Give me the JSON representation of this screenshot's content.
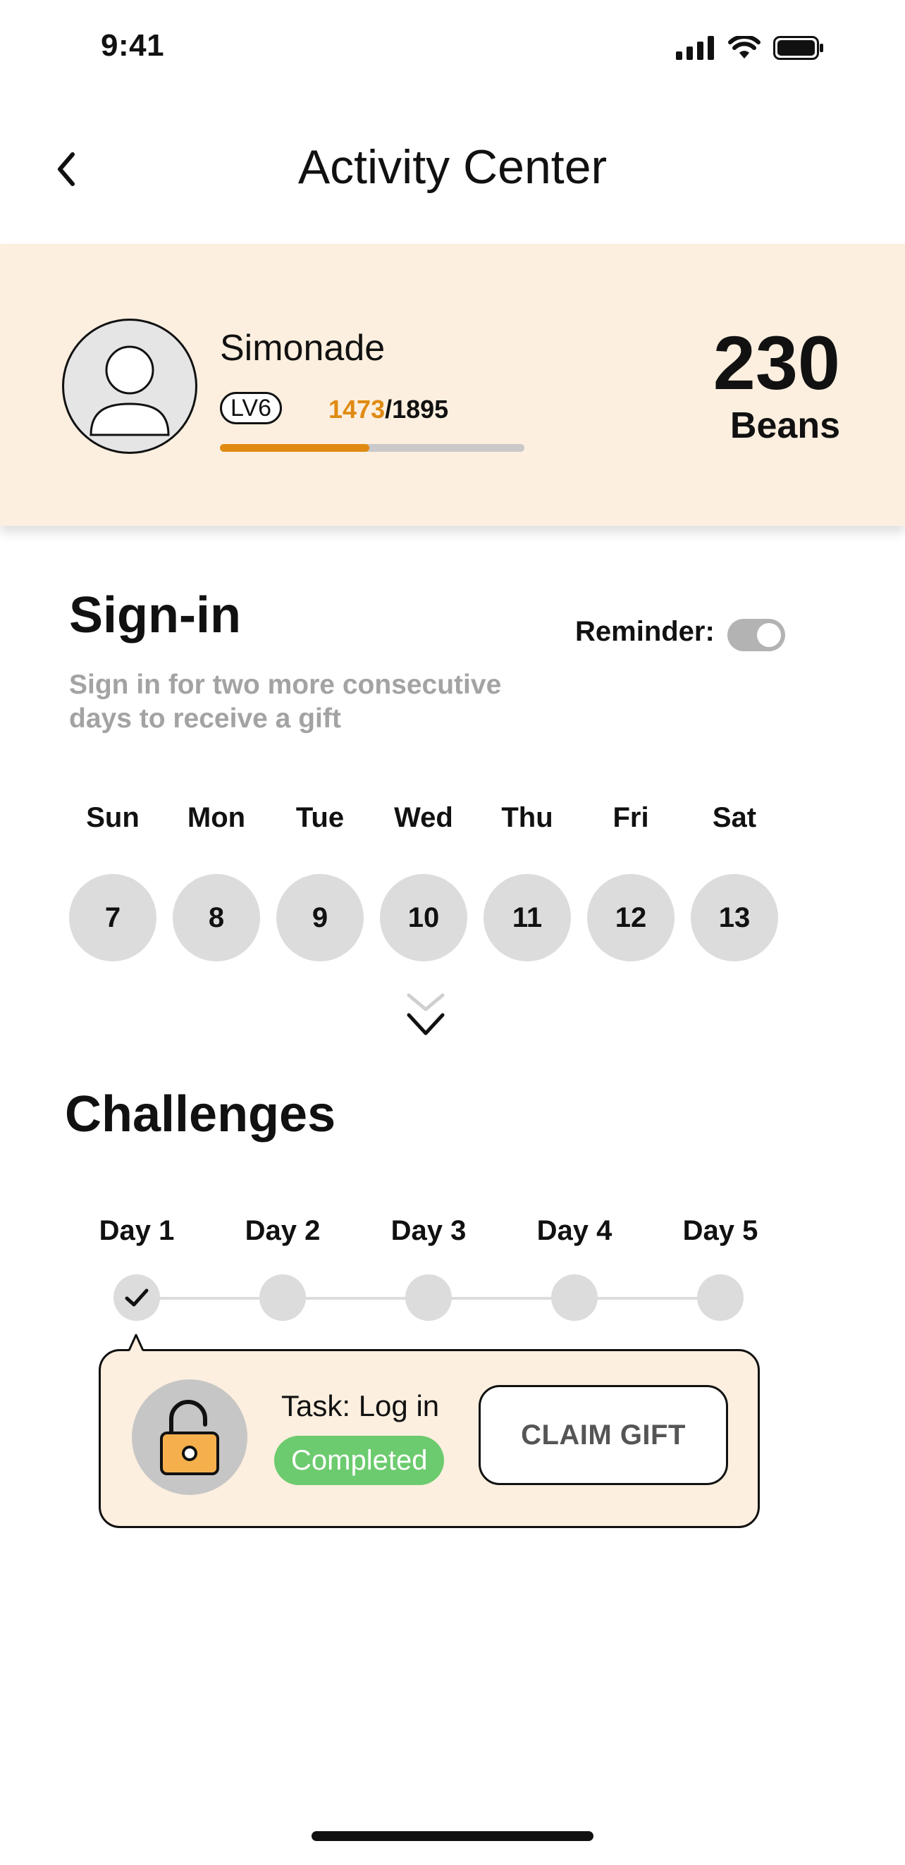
{
  "status_bar": {
    "time": "9:41"
  },
  "nav": {
    "title": "Activity Center"
  },
  "profile": {
    "username": "Simonade",
    "level": "LV6",
    "xp_current": "1473",
    "xp_separator": "/",
    "xp_total": "1895",
    "xp_progress_fraction": 0.49,
    "beans_value": "230",
    "beans_label": "Beans"
  },
  "signin": {
    "title": "Sign-in",
    "reminder_label": "Reminder:",
    "reminder_on": true,
    "description": "Sign in for two more consecutive days to receive a gift",
    "days": [
      {
        "name": "Sun",
        "date": "7"
      },
      {
        "name": "Mon",
        "date": "8"
      },
      {
        "name": "Tue",
        "date": "9"
      },
      {
        "name": "Wed",
        "date": "10"
      },
      {
        "name": "Thu",
        "date": "11"
      },
      {
        "name": "Fri",
        "date": "12"
      },
      {
        "name": "Sat",
        "date": "13"
      }
    ]
  },
  "challenges": {
    "title": "Challenges",
    "days": [
      {
        "label": "Day 1",
        "completed": true
      },
      {
        "label": "Day 2",
        "completed": false
      },
      {
        "label": "Day 3",
        "completed": false
      },
      {
        "label": "Day 4",
        "completed": false
      },
      {
        "label": "Day 5",
        "completed": false
      }
    ],
    "task": {
      "text": "Task: Log in",
      "status": "Completed",
      "claim_label": "CLAIM GIFT"
    }
  },
  "colors": {
    "accent": "#e08a12",
    "card_background": "#fcefdf",
    "success": "#6ccb6e",
    "lock": "#f5b04d"
  },
  "icons": [
    "signal-icon",
    "wifi-icon",
    "battery-icon",
    "back-chevron-icon",
    "avatar-icon",
    "double-chevron-down-icon",
    "checkmark-icon",
    "unlock-icon"
  ]
}
